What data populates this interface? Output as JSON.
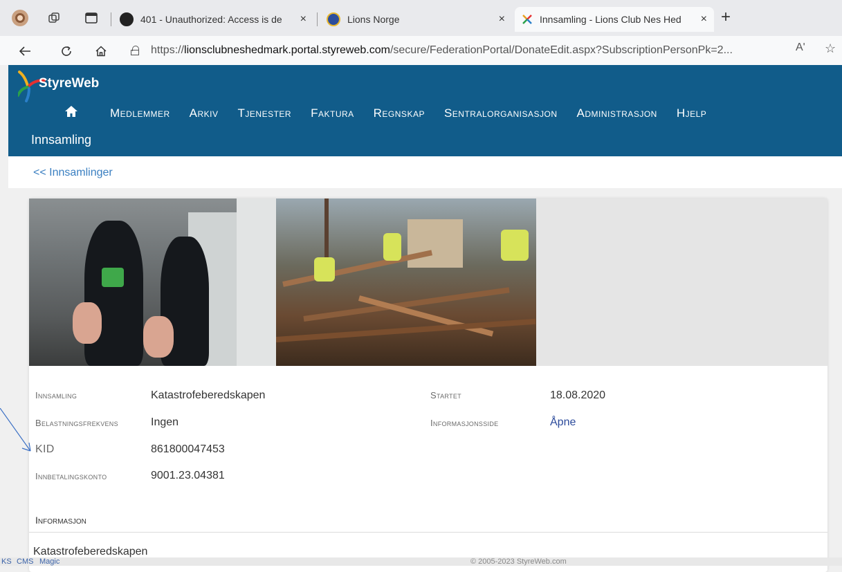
{
  "browser": {
    "tabs": [
      {
        "title": "401 - Unauthorized: Access is de",
        "favicon_color": "#222222"
      },
      {
        "title": "Lions Norge",
        "favicon_color": "#2d4e9c"
      },
      {
        "title": "Innsamling - Lions Club Nes Hed",
        "favicon_color": "#e8a020"
      }
    ],
    "new_tab": "+",
    "close_glyph": "×",
    "url_host": "lionsclubneshedmark.portal.styreweb.com",
    "url_scheme": "https://",
    "url_path": "/secure/FederationPortal/DonateEdit.aspx?SubscriptionPersonPk=2...",
    "read_aloud": "Aʹ",
    "favorite": "☆"
  },
  "site": {
    "brand": "StyreWeb",
    "colors": {
      "header": "#115c8a",
      "link": "#3a7fc1"
    },
    "menu": [
      "Medlemmer",
      "Arkiv",
      "Tjenester",
      "Faktura",
      "Regnskap",
      "Sentralorganisasjon",
      "Administrasjon",
      "Hjelp"
    ],
    "submenu": "Innsamling"
  },
  "breadcrumb": "<< Innsamlinger",
  "details": {
    "innsamling_label": "Innsamling",
    "innsamling_value": "Katastrofeberedskapen",
    "frekvens_label": "Belastningsfrekvens",
    "frekvens_value": "Ingen",
    "kid_label": "KID",
    "kid_value": "861800047453",
    "konto_label": "Innbetalingskonto",
    "konto_value": "9001.23.04381",
    "startet_label": "Startet",
    "startet_value": "18.08.2020",
    "infoside_label": "Informasjonsside",
    "infoside_value": "Åpne"
  },
  "info_section": {
    "title": "Informasjon",
    "text": "Katastrofeberedskapen"
  },
  "footer": {
    "links": [
      "KS",
      "CMS",
      "Magic"
    ],
    "copyright": "© 2005-2023 StyreWeb.com"
  }
}
